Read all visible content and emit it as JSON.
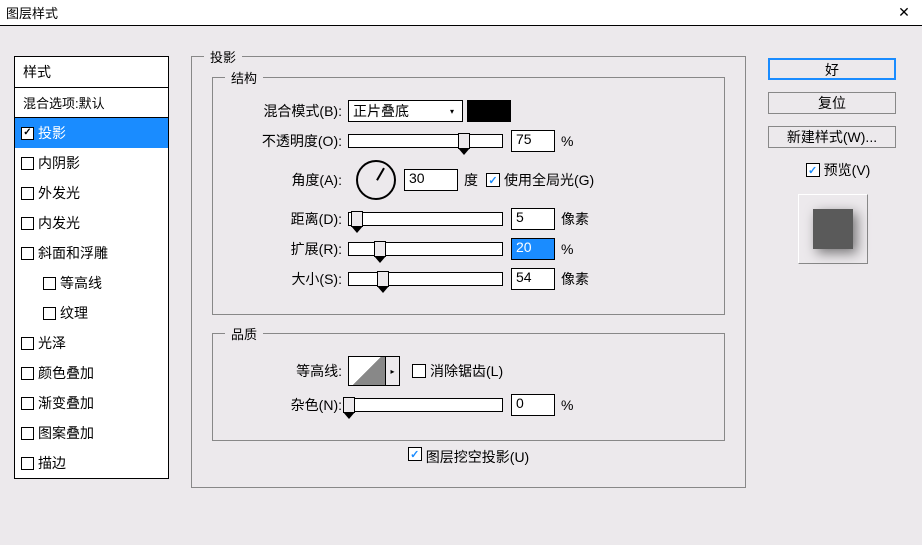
{
  "window": {
    "title": "图层样式"
  },
  "list": {
    "header_styles": "样式",
    "header_blend": "混合选项:默认",
    "items": [
      {
        "label": "投影",
        "checked": true,
        "selected": true
      },
      {
        "label": "内阴影",
        "checked": false
      },
      {
        "label": "外发光",
        "checked": false
      },
      {
        "label": "内发光",
        "checked": false
      },
      {
        "label": "斜面和浮雕",
        "checked": false
      },
      {
        "label": "等高线",
        "checked": false,
        "indent": true
      },
      {
        "label": "纹理",
        "checked": false,
        "indent": true
      },
      {
        "label": "光泽",
        "checked": false
      },
      {
        "label": "颜色叠加",
        "checked": false
      },
      {
        "label": "渐变叠加",
        "checked": false
      },
      {
        "label": "图案叠加",
        "checked": false
      },
      {
        "label": "描边",
        "checked": false
      }
    ]
  },
  "panel": {
    "title": "投影",
    "structure": {
      "legend": "结构",
      "blend_mode_label": "混合模式(B):",
      "blend_mode_value": "正片叠底",
      "opacity_label": "不透明度(O):",
      "opacity_value": "75",
      "opacity_unit": "%",
      "angle_label": "角度(A):",
      "angle_value": "30",
      "angle_unit": "度",
      "global_light_label": "使用全局光(G)",
      "distance_label": "距离(D):",
      "distance_value": "5",
      "distance_unit": "像素",
      "spread_label": "扩展(R):",
      "spread_value": "20",
      "spread_unit": "%",
      "size_label": "大小(S):",
      "size_value": "54",
      "size_unit": "像素"
    },
    "quality": {
      "legend": "品质",
      "contour_label": "等高线:",
      "antialias_label": "消除锯齿(L)",
      "noise_label": "杂色(N):",
      "noise_value": "0",
      "noise_unit": "%"
    },
    "knockout_label": "图层挖空投影(U)"
  },
  "buttons": {
    "ok": "好",
    "reset": "复位",
    "new_style": "新建样式(W)...",
    "preview": "预览(V)"
  }
}
